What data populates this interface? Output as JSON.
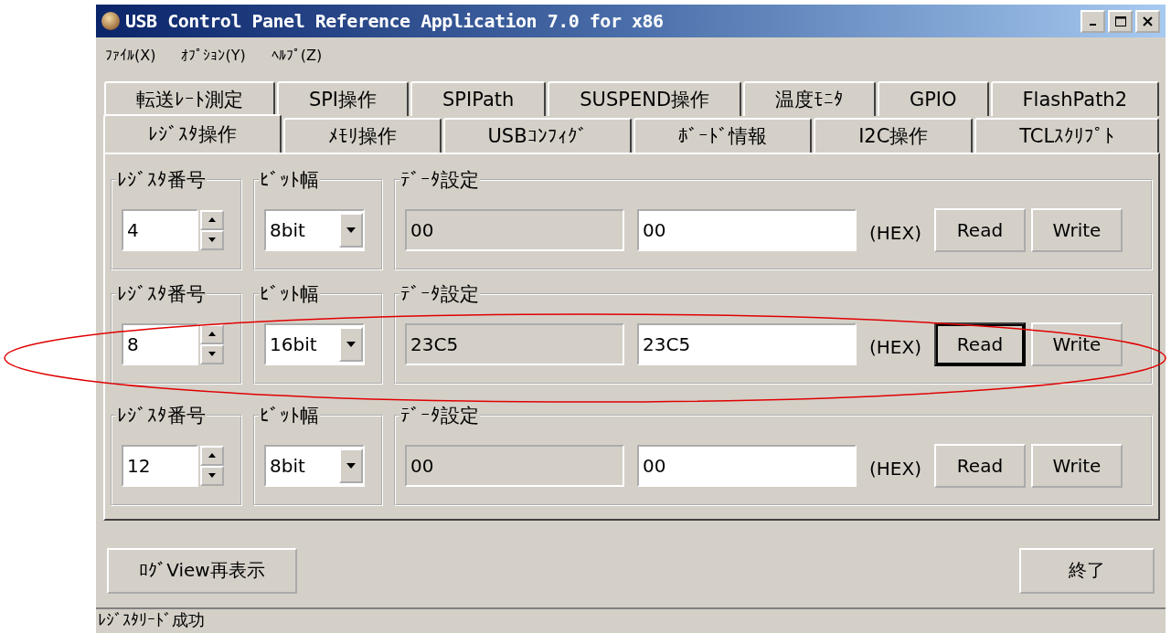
{
  "window": {
    "title": "USB Control Panel Reference Application 7.0 for x86"
  },
  "menu": [
    "ﾌｧｲﾙ(X)",
    "ｵﾌﾟｼｮﾝ(Y)",
    "ﾍﾙﾌﾟ(Z)"
  ],
  "tab_rows": [
    [
      {
        "label": "転送ﾚｰﾄ測定",
        "selected": false
      },
      {
        "label": "SPI操作",
        "selected": false
      },
      {
        "label": "SPIPath",
        "selected": false
      },
      {
        "label": "SUSPEND操作",
        "selected": false
      },
      {
        "label": "温度ﾓﾆﾀ",
        "selected": false
      },
      {
        "label": "GPIO",
        "selected": false
      },
      {
        "label": "FlashPath2",
        "selected": false
      }
    ],
    [
      {
        "label": "ﾚｼﾞｽﾀ操作",
        "selected": true
      },
      {
        "label": "ﾒﾓﾘ操作",
        "selected": false
      },
      {
        "label": "USBｺﾝﾌｨｸﾞ",
        "selected": false
      },
      {
        "label": "ﾎﾞｰﾄﾞ情報",
        "selected": false
      },
      {
        "label": "I2C操作",
        "selected": false
      },
      {
        "label": "TCLｽｸﾘﾌﾟﾄ",
        "selected": false
      }
    ]
  ],
  "registers": [
    {
      "number_label": "ﾚｼﾞｽﾀ番号",
      "number": "4",
      "bit_width_label": "ﾋﾞｯﾄ幅",
      "bit_width": "8bit",
      "data_label": "ﾃﾞｰﾀ設定",
      "read_value": "00",
      "write_value": "00",
      "unit": "(HEX)",
      "buttons": [
        {
          "label": "Read",
          "focused": false
        },
        {
          "label": "Write",
          "focused": false
        }
      ]
    },
    {
      "number_label": "ﾚｼﾞｽﾀ番号",
      "number": "8",
      "bit_width_label": "ﾋﾞｯﾄ幅",
      "bit_width": "16bit",
      "data_label": "ﾃﾞｰﾀ設定",
      "read_value": "23C5",
      "write_value": "23C5",
      "unit": "(HEX)",
      "buttons": [
        {
          "label": "Read",
          "focused": true
        },
        {
          "label": "Write",
          "focused": false
        }
      ]
    },
    {
      "number_label": "ﾚｼﾞｽﾀ番号",
      "number": "12",
      "bit_width_label": "ﾋﾞｯﾄ幅",
      "bit_width": "8bit",
      "data_label": "ﾃﾞｰﾀ設定",
      "read_value": "00",
      "write_value": "00",
      "unit": "(HEX)",
      "buttons": [
        {
          "label": "Read",
          "focused": false
        },
        {
          "label": "Write",
          "focused": false
        }
      ]
    }
  ],
  "bottom_buttons": [
    "ﾛｸﾞView再表示",
    "終了"
  ],
  "status_bar": "ﾚｼﾞｽﾀﾘｰﾄﾞ成功"
}
